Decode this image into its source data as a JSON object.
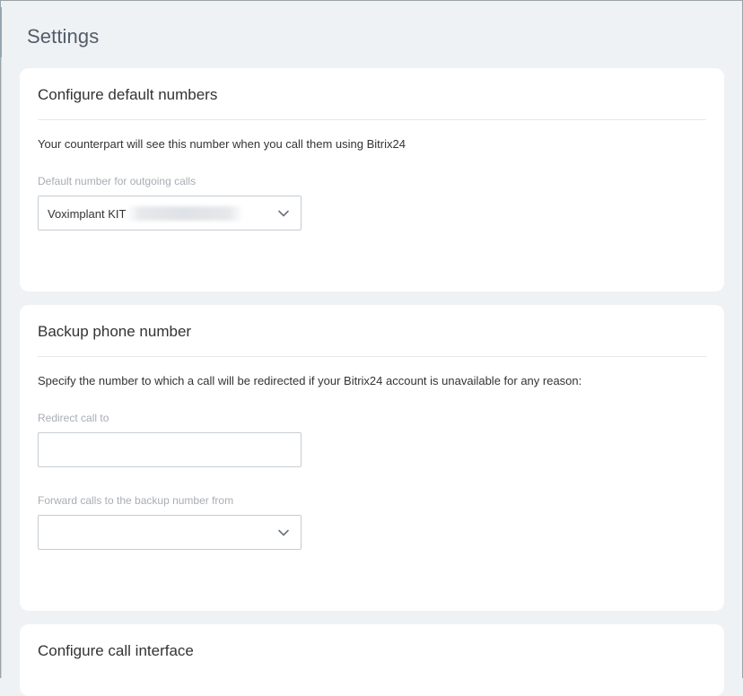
{
  "page": {
    "title": "Settings"
  },
  "default_numbers": {
    "title": "Configure default numbers",
    "description": "Your counterpart will see this number when you call them using Bitrix24",
    "outgoing_label": "Default number for outgoing calls",
    "outgoing_value": "Voximplant KIT"
  },
  "backup": {
    "title": "Backup phone number",
    "description": "Specify the number to which a call will be redirected if your Bitrix24 account is unavailable for any reason:",
    "redirect_label": "Redirect call to",
    "redirect_value": "",
    "forward_label": "Forward calls to the backup number from",
    "forward_value": ""
  },
  "call_interface": {
    "title": "Configure call interface"
  },
  "icons": {
    "select_arrow": "chevron-down-icon",
    "redacted": "blurred-number"
  },
  "colors": {
    "background": "#eef2f4",
    "card": "#ffffff",
    "accent": "#3bc8f5"
  }
}
